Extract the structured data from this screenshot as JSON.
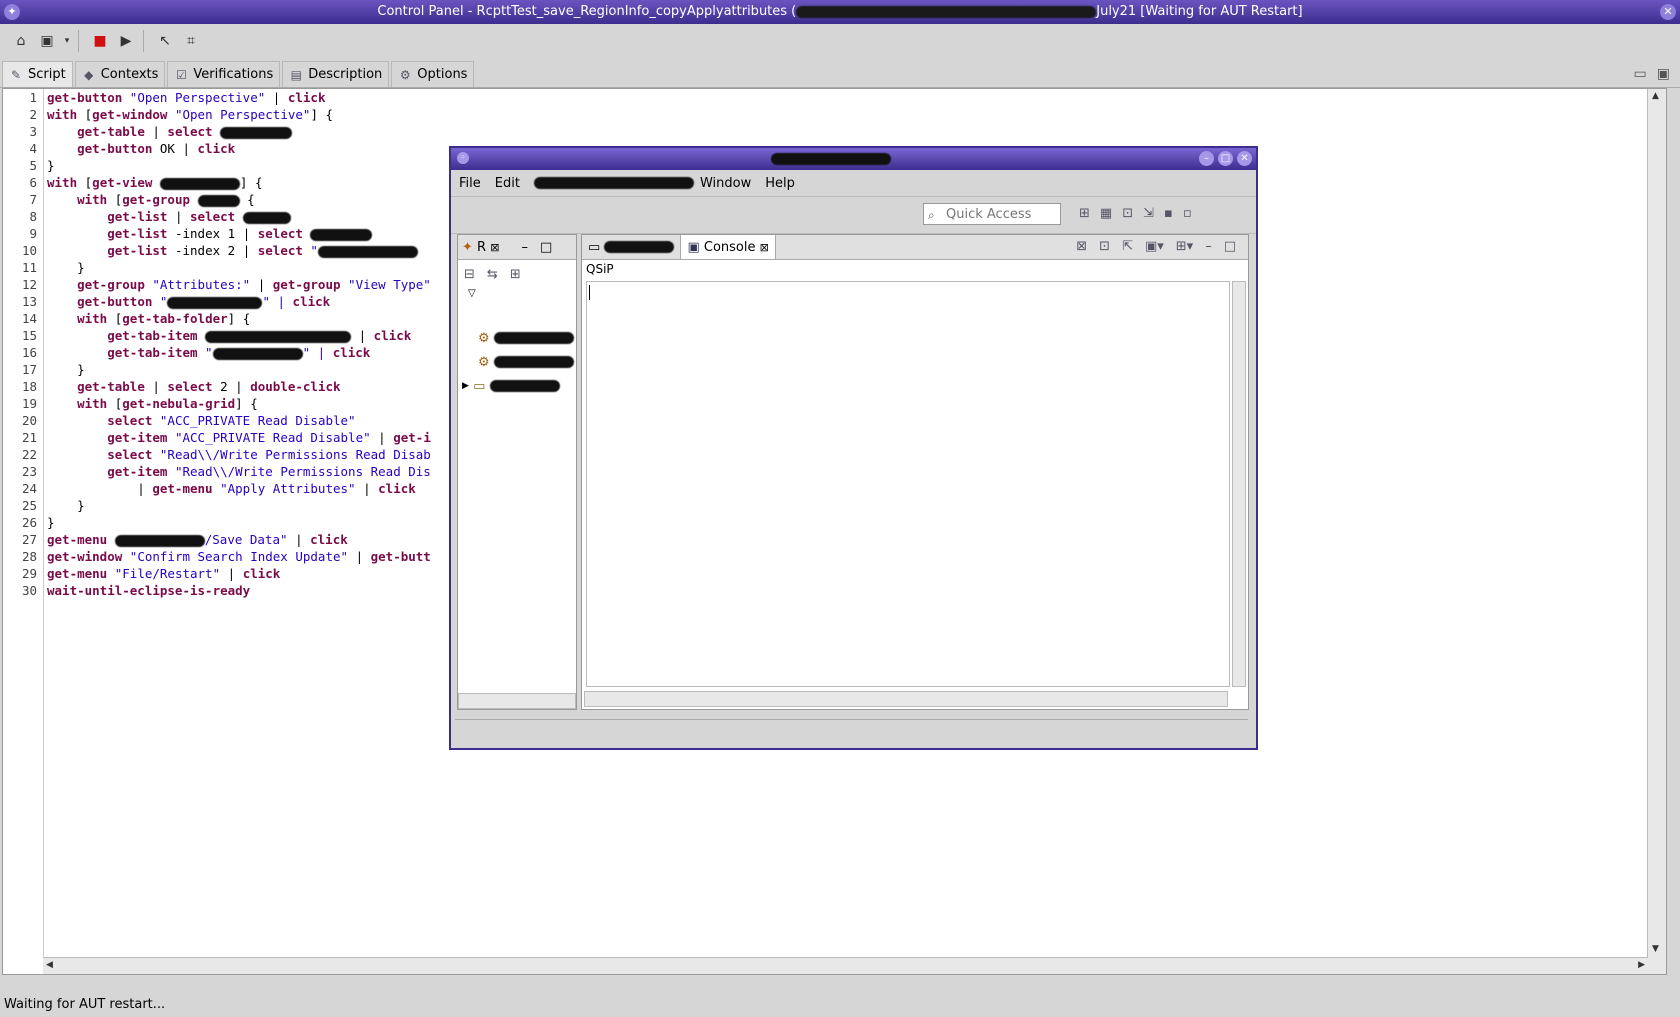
{
  "window": {
    "title_prefix": "Control Panel - RcpttTest_save_RegionInfo_copyApplyattributes (",
    "title_suffix": "July21 [Waiting for AUT Restart]"
  },
  "tabs": [
    {
      "label": "Script",
      "icon": "script-icon"
    },
    {
      "label": "Contexts",
      "icon": "contexts-icon"
    },
    {
      "label": "Verifications",
      "icon": "verifications-icon"
    },
    {
      "label": "Description",
      "icon": "description-icon"
    },
    {
      "label": "Options",
      "icon": "options-icon"
    }
  ],
  "editor": {
    "line_numbers": [
      "1",
      "2",
      "3",
      "4",
      "5",
      "6",
      "7",
      "8",
      "9",
      "10",
      "11",
      "12",
      "13",
      "14",
      "15",
      "16",
      "17",
      "18",
      "19",
      "20",
      "21",
      "22",
      "23",
      "24",
      "25",
      "26",
      "27",
      "28",
      "29",
      "30"
    ]
  },
  "code": {
    "l1": [
      "get-button",
      " \"Open Perspective\"",
      " | ",
      "click"
    ],
    "l2": [
      "with",
      " [",
      "get-window",
      " \"Open Perspective\"",
      "] {"
    ],
    "l3": [
      "    ",
      "get-table",
      " | ",
      "select"
    ],
    "l4": [
      "    ",
      "get-button",
      " OK | ",
      "click"
    ],
    "l5": "}",
    "l6": [
      "with",
      " [",
      "get-view",
      "] {"
    ],
    "l7": [
      "    ",
      "with",
      " [",
      "get-group",
      " {"
    ],
    "l8": [
      "        ",
      "get-list",
      " | ",
      "select"
    ],
    "l9": [
      "        ",
      "get-list",
      " -index 1 | ",
      "select"
    ],
    "l10": [
      "        ",
      "get-list",
      " -index 2 | ",
      "select",
      " \""
    ],
    "l11": "    }",
    "l12": [
      "    ",
      "get-group",
      " \"Attributes:\"",
      " | ",
      "get-group",
      " \"View Type\""
    ],
    "l13": [
      "    ",
      "get-button",
      " \"",
      "\" | ",
      "click"
    ],
    "l14": [
      "    ",
      "with",
      " [",
      "get-tab-folder",
      "] {"
    ],
    "l15": [
      "        ",
      "get-tab-item",
      " ",
      " | ",
      "click"
    ],
    "l16": [
      "        ",
      "get-tab-item",
      " \"",
      "\" | ",
      "click"
    ],
    "l17": "    }",
    "l18": [
      "    ",
      "get-table",
      " | ",
      "select",
      " 2 | ",
      "double-click"
    ],
    "l19": [
      "    ",
      "with",
      " [",
      "get-nebula-grid",
      "] {"
    ],
    "l20": [
      "        ",
      "select",
      " \"ACC_PRIVATE Read Disable\""
    ],
    "l21": [
      "        ",
      "get-item",
      " \"ACC_PRIVATE Read Disable\"",
      " | ",
      "get-i"
    ],
    "l22": [
      "        ",
      "select",
      " \"Read\\\\/Write Permissions Read Disab"
    ],
    "l23": [
      "        ",
      "get-item",
      " \"Read\\\\/Write Permissions Read Dis"
    ],
    "l24": [
      "            | ",
      "get-menu",
      " \"Apply Attributes\"",
      " | ",
      "click"
    ],
    "l25": "    }",
    "l26": "}",
    "l27": [
      "get-menu",
      " ",
      "/Save Data\"",
      " | ",
      "click"
    ],
    "l28": [
      "get-window",
      " \"Confirm Search Index Update\"",
      " | ",
      "get-butt"
    ],
    "l29": [
      "get-menu",
      " \"File/Restart\"",
      " | ",
      "click"
    ],
    "l30": [
      "wait-until-eclipse-is-ready"
    ]
  },
  "aut": {
    "menu": [
      "File",
      "Edit",
      "Window",
      "Help"
    ],
    "quick_access_placeholder": "Quick Access",
    "left_tab_label": "R",
    "console_tab_label": "Console",
    "console_title": "QSiP"
  },
  "status": "Waiting for AUT restart..."
}
